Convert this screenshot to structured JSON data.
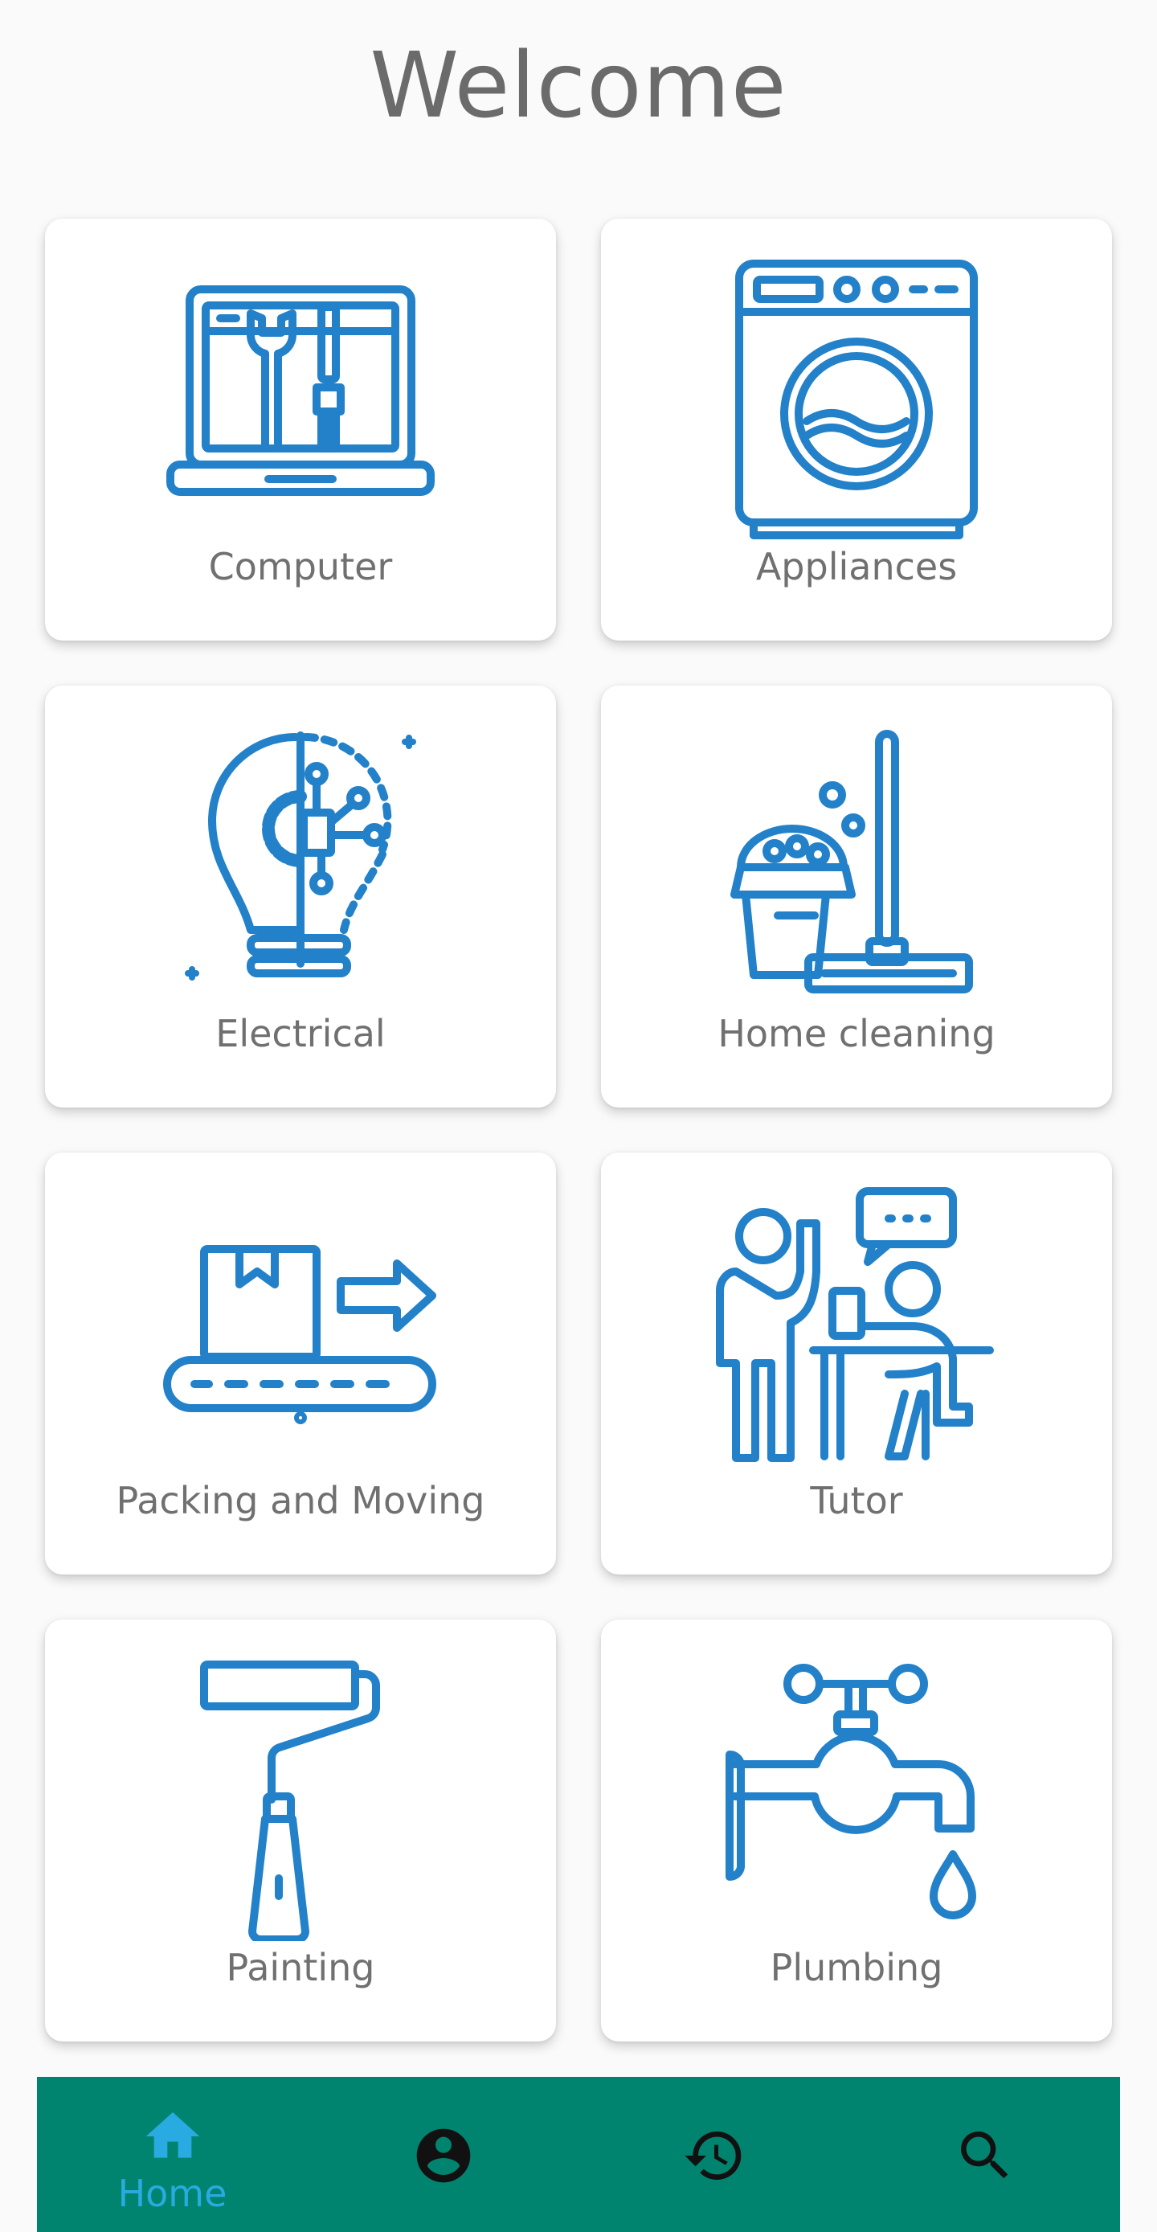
{
  "page": {
    "title": "Welcome"
  },
  "categories": [
    {
      "label": "Computer",
      "icon": "laptop-tools-icon"
    },
    {
      "label": "Appliances",
      "icon": "washing-machine-icon"
    },
    {
      "label": "Electrical",
      "icon": "lightbulb-circuit-icon"
    },
    {
      "label": "Home cleaning",
      "icon": "mop-bucket-icon"
    },
    {
      "label": "Packing and Moving",
      "icon": "conveyor-box-icon"
    },
    {
      "label": "Tutor",
      "icon": "teacher-student-icon"
    },
    {
      "label": "Painting",
      "icon": "paint-roller-icon"
    },
    {
      "label": "Plumbing",
      "icon": "faucet-icon"
    }
  ],
  "nav": {
    "items": [
      {
        "label": "Home",
        "icon": "home-icon",
        "active": true
      },
      {
        "label": "",
        "icon": "account-icon",
        "active": false
      },
      {
        "label": "",
        "icon": "history-icon",
        "active": false
      },
      {
        "label": "",
        "icon": "search-icon",
        "active": false
      }
    ]
  },
  "colors": {
    "icon_blue": "#2381c9",
    "nav_bg": "#00846f",
    "nav_active": "#29aae1",
    "nav_inactive": "#111111",
    "text_gray": "#707070"
  }
}
